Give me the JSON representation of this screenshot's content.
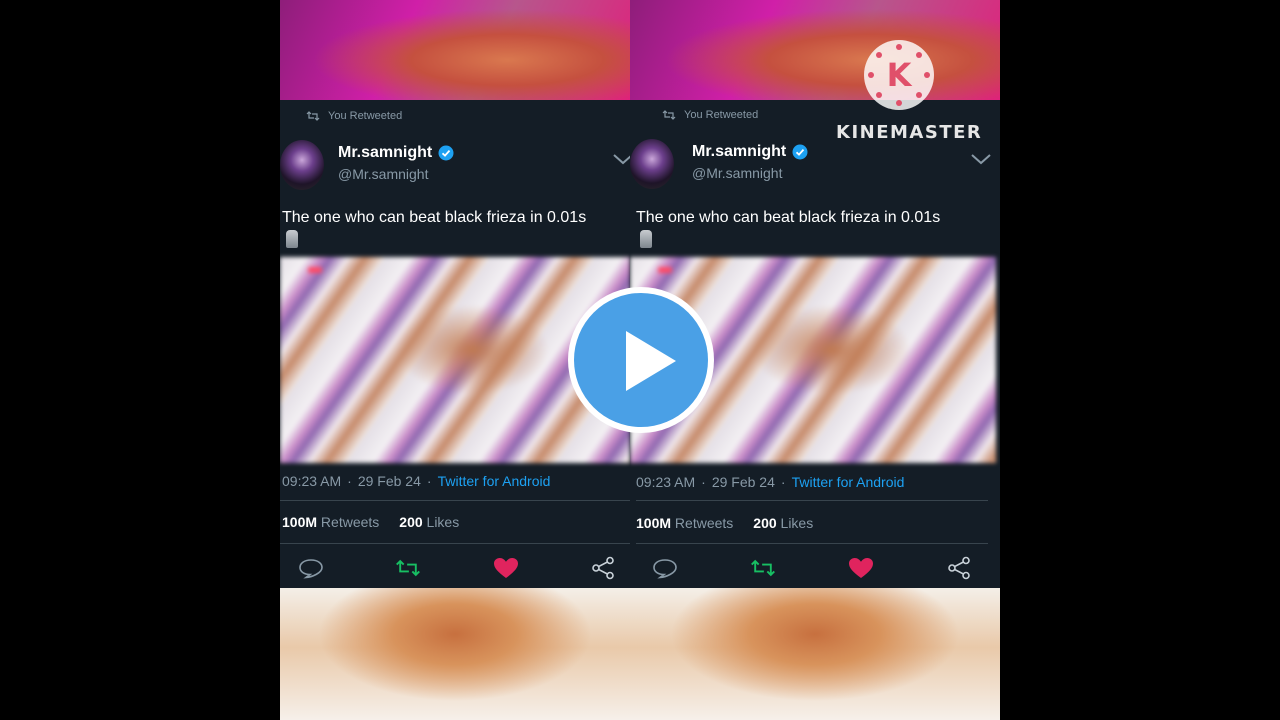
{
  "tweet": {
    "retweet_label": "You Retweeted",
    "display_name": "Mr.samnight",
    "handle": "@Mr.samnight",
    "text": "The one who can beat black frieza in 0.01s",
    "emoji": "moai-emoji",
    "time": "09:23 AM",
    "date": "29 Feb 24",
    "separator": "·",
    "source": "Twitter for Android",
    "retweets_count": "100M",
    "retweets_label": "Retweets",
    "likes_count": "200",
    "likes_label": "Likes"
  },
  "watermark": {
    "logo_letter": "K",
    "brand": "KINEMASTER"
  },
  "icons": {
    "reply": "speech-bubble-icon",
    "retweet": "retweet-icon",
    "like": "heart-icon",
    "share": "share-icon",
    "play": "play-icon",
    "verified": "verified-badge-icon"
  },
  "colors": {
    "background": "#141d26",
    "link": "#1da1f2",
    "retweet_green": "#17bf63",
    "like_red": "#e0245e",
    "play_blue": "#4aa0e6",
    "muted": "#8899a6"
  }
}
